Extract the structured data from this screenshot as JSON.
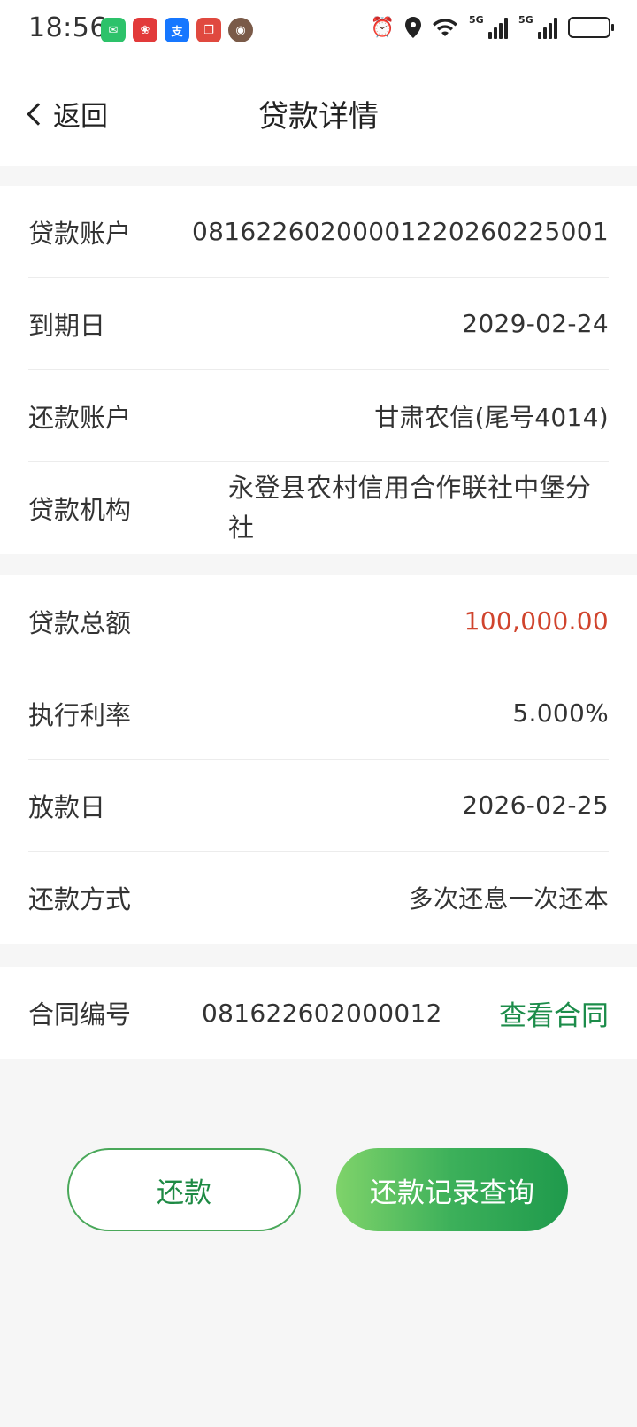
{
  "status_bar": {
    "time": "18:56",
    "apps": [
      {
        "icon": "wechat-icon",
        "color": "#2dc26a",
        "glyph": "✉"
      },
      {
        "icon": "app-red-icon",
        "color": "#e23a3a",
        "glyph": "❀"
      },
      {
        "icon": "alipay-icon",
        "color": "#1677ff",
        "glyph": "支"
      },
      {
        "icon": "book-app-icon",
        "color": "#e0493f",
        "glyph": "❐"
      },
      {
        "icon": "avatar-app-icon",
        "color": "#7a5a48",
        "glyph": "◉"
      }
    ],
    "network_1": "5G",
    "network_2": "5G"
  },
  "nav": {
    "back_label": "返回",
    "title": "贷款详情"
  },
  "section1": [
    {
      "label": "贷款账户",
      "value": "081622602000012202602250 01"
    },
    {
      "label": "到期日",
      "value": "2029-02-24"
    },
    {
      "label": "还款账户",
      "value": "甘肃农信(尾号4014)"
    },
    {
      "label": "贷款机构",
      "value": "永登县农村信用合作联社中堡分社"
    }
  ],
  "section2": [
    {
      "label": "贷款总额",
      "value": "100,000.00"
    },
    {
      "label": "执行利率",
      "value": "5.000%"
    },
    {
      "label": "放款日",
      "value": "2026-02-25"
    },
    {
      "label": "还款方式",
      "value": "多次还息一次还本"
    }
  ],
  "contract": {
    "label": "合同编号",
    "number": "081622602000012",
    "link": "查看合同"
  },
  "buttons": {
    "repay": "还款",
    "record": "还款记录查询"
  },
  "colors": {
    "accent_green": "#1c8c4a",
    "amount_red": "#d0442d"
  }
}
